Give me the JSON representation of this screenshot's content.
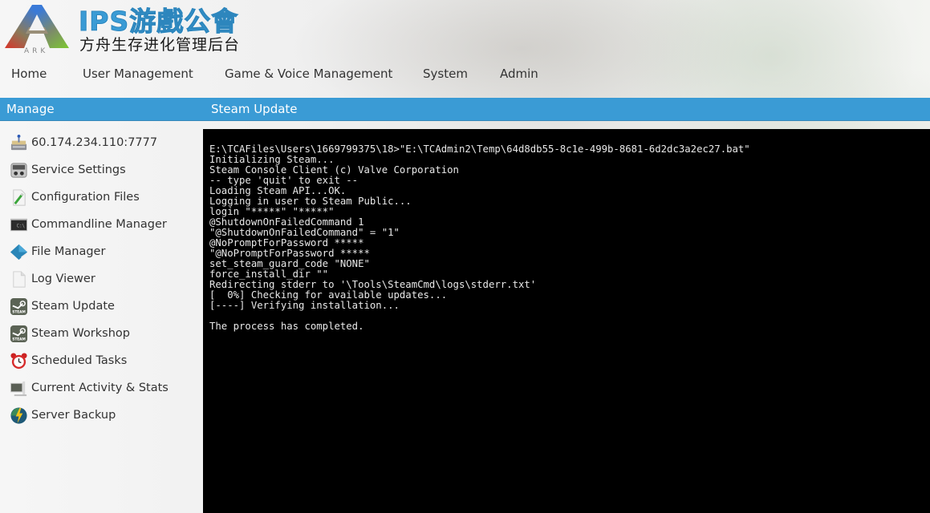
{
  "header": {
    "brand_title": "IPS游戲公會",
    "brand_subtitle": "方舟生存进化管理后台",
    "logo_icon": "ark-logo-icon"
  },
  "top_nav": {
    "items": [
      {
        "label": "Home"
      },
      {
        "label": "User Management"
      },
      {
        "label": "Game & Voice Management"
      },
      {
        "label": "System"
      },
      {
        "label": "Admin"
      }
    ]
  },
  "section_bar": {
    "left_label": "Manage",
    "right_label": "Steam Update",
    "color": "#3a9bd5"
  },
  "sidebar": {
    "items": [
      {
        "label": "60.174.234.110:7777",
        "icon": "server-icon"
      },
      {
        "label": "Service Settings",
        "icon": "settings-panel-icon"
      },
      {
        "label": "Configuration Files",
        "icon": "edit-file-icon"
      },
      {
        "label": "Commandline Manager",
        "icon": "terminal-icon"
      },
      {
        "label": "File Manager",
        "icon": "folder-diamond-icon"
      },
      {
        "label": "Log Viewer",
        "icon": "document-icon"
      },
      {
        "label": "Steam Update",
        "icon": "steam-icon"
      },
      {
        "label": "Steam Workshop",
        "icon": "steam-icon"
      },
      {
        "label": "Scheduled Tasks",
        "icon": "alarm-clock-icon"
      },
      {
        "label": "Current Activity & Stats",
        "icon": "monitor-icon"
      },
      {
        "label": "Server Backup",
        "icon": "backup-bolt-icon"
      }
    ]
  },
  "console": {
    "lines": [
      "E:\\TCAFiles\\Users\\1669799375\\18>\"E:\\TCAdmin2\\Temp\\64d8db55-8c1e-499b-8681-6d2dc3a2ec27.bat\"",
      "Initializing Steam...",
      "Steam Console Client (c) Valve Corporation",
      "-- type 'quit' to exit --",
      "Loading Steam API...OK.",
      "Logging in user to Steam Public...",
      "login \"*****\" \"*****\"",
      "@ShutdownOnFailedCommand 1",
      "\"@ShutdownOnFailedCommand\" = \"1\"",
      "@NoPromptForPassword *****",
      "\"@NoPromptForPassword *****",
      "set_steam_guard_code \"NONE\"",
      "force_install_dir \"\"",
      "Redirecting stderr to '\\Tools\\SteamCmd\\logs\\stderr.txt'",
      "[  0%] Checking for available updates...",
      "[----] Verifying installation...",
      "",
      "The process has completed."
    ]
  }
}
